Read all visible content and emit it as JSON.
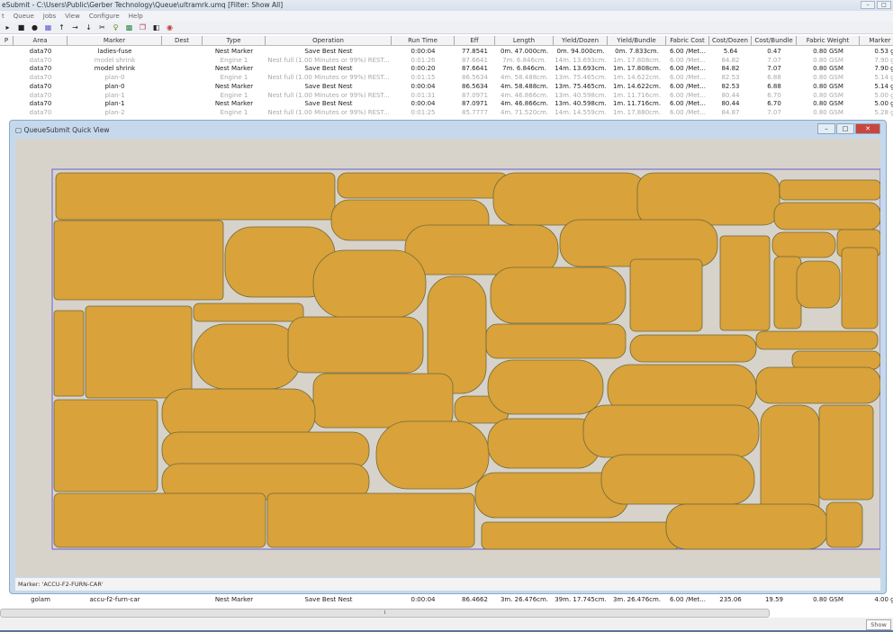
{
  "window": {
    "title": "eSubmit - C:\\Users\\Public\\Gerber Technology\\Queue\\ultramrk.umq   [Filter: Show All]"
  },
  "menu": [
    "t",
    "Queue",
    "Jobs",
    "View",
    "Configure",
    "Help"
  ],
  "toolbar_icons": [
    "play-icon",
    "stop-icon",
    "record-icon",
    "grid-icon",
    "move-up-icon",
    "move-right-icon",
    "move-down-icon",
    "cut-icon",
    "key-icon",
    "chart-icon",
    "copy-icon",
    "export-icon",
    "delete-icon"
  ],
  "columns": [
    "P",
    "Area",
    "Marker",
    "Dest",
    "Type",
    "Operation",
    "Run Time",
    "Eff",
    "Length",
    "Yield/Dozen",
    "Yield/Bundle",
    "Fabric Cost",
    "Cost/Dozen",
    "Cost/Bundle",
    "Fabric Weight",
    "Marker W"
  ],
  "rows": [
    {
      "style": "dark",
      "cells": [
        "",
        "data70",
        "ladies-fuse",
        "",
        "Nest Marker",
        "Save Best Nest",
        "0:00:04",
        "77.8541",
        "0m. 47.000cm.",
        "0m. 94.000cm.",
        "0m. 7.833cm.",
        "6.00 /Met...",
        "5.64",
        "0.47",
        "0.80 GSM",
        "0.53 g"
      ]
    },
    {
      "style": "light",
      "cells": [
        "",
        "data70",
        "model shrink",
        "",
        "Engine 1",
        "Nest full (1.00 Minutes or 99%) REST...",
        "0:01:26",
        "87.6641",
        "7m. 6.846cm.",
        "14m. 13.693cm.",
        "1m. 17.808cm.",
        "6.00 /Met...",
        "84.82",
        "7.07",
        "0.80 GSM",
        "7.90 g"
      ]
    },
    {
      "style": "dark",
      "cells": [
        "",
        "data70",
        "model shrink",
        "",
        "Nest Marker",
        "Save Best Nest",
        "0:00:20",
        "87.6641",
        "7m. 6.846cm.",
        "14m. 13.693cm.",
        "1m. 17.808cm.",
        "6.00 /Met...",
        "84.82",
        "7.07",
        "0.80 GSM",
        "7.90 g"
      ]
    },
    {
      "style": "light",
      "cells": [
        "",
        "data70",
        "plan-0",
        "",
        "Engine 1",
        "Nest full (1.00 Minutes or 99%) REST...",
        "0:01:15",
        "86.5634",
        "4m. 58.488cm.",
        "13m. 75.465cm.",
        "1m. 14.622cm.",
        "6.00 /Met...",
        "82.53",
        "6.88",
        "0.80 GSM",
        "5.14 g"
      ]
    },
    {
      "style": "dark",
      "cells": [
        "",
        "data70",
        "plan-0",
        "",
        "Nest Marker",
        "Save Best Nest",
        "0:00:04",
        "86.5634",
        "4m. 58.488cm.",
        "13m. 75.465cm.",
        "1m. 14.622cm.",
        "6.00 /Met...",
        "82.53",
        "6.88",
        "0.80 GSM",
        "5.14 g"
      ]
    },
    {
      "style": "light",
      "cells": [
        "",
        "data70",
        "plan-1",
        "",
        "Engine 1",
        "Nest full (1.00 Minutes or 99%) REST...",
        "0:01:31",
        "87.0971",
        "4m. 46.866cm.",
        "13m. 40.598cm.",
        "1m. 11.716cm.",
        "6.00 /Met...",
        "80.44",
        "6.70",
        "0.80 GSM",
        "5.00 g"
      ]
    },
    {
      "style": "dark",
      "cells": [
        "",
        "data70",
        "plan-1",
        "",
        "Nest Marker",
        "Save Best Nest",
        "0:00:04",
        "87.0971",
        "4m. 46.866cm.",
        "13m. 40.598cm.",
        "1m. 11.716cm.",
        "6.00 /Met...",
        "80.44",
        "6.70",
        "0.80 GSM",
        "5.00 g"
      ]
    },
    {
      "style": "light",
      "cells": [
        "",
        "data70",
        "plan-2",
        "",
        "Engine 1",
        "Nest full (1.00 Minutes or 99%) REST...",
        "0:01:25",
        "85.7777",
        "4m. 71.520cm.",
        "14m. 14.559cm.",
        "1m. 17.880cm.",
        "6.00 /Met...",
        "84.87",
        "7.07",
        "0.80 GSM",
        "5.28 g"
      ]
    }
  ],
  "bottom_row": {
    "style": "dark",
    "cells": [
      "",
      "golam",
      "accu-f2-furn-car",
      "",
      "Nest Marker",
      "Save Best Nest",
      "0:00:04",
      "86.4662",
      "3m. 26.476cm.",
      "39m. 17.745cm.",
      "3m. 26.476cm.",
      "6.00 /Met...",
      "235.06",
      "19.59",
      "0.80 GSM",
      "4.00 g"
    ]
  },
  "quick_view": {
    "title": "QueueSubmit Quick View",
    "status": "Marker: 'ACCU-F2-FURN-CAR'",
    "piece_color": "#d9a23a",
    "background_color": "#d7d3cb",
    "marker_border_color": "#6a5fd0"
  },
  "show_button": "Show"
}
